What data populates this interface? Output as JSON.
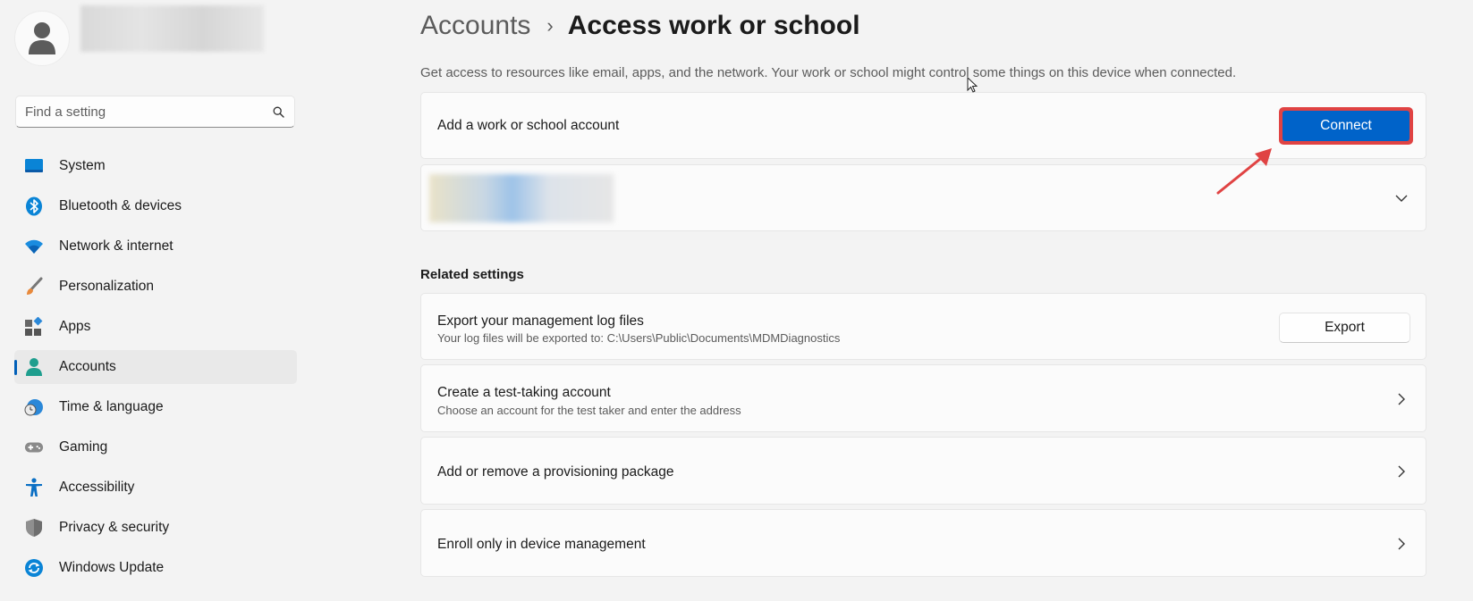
{
  "sidebar": {
    "search_placeholder": "Find a setting",
    "items": [
      {
        "label": "System",
        "icon": "monitor-icon"
      },
      {
        "label": "Bluetooth & devices",
        "icon": "bluetooth-icon"
      },
      {
        "label": "Network & internet",
        "icon": "wifi-icon"
      },
      {
        "label": "Personalization",
        "icon": "paintbrush-icon"
      },
      {
        "label": "Apps",
        "icon": "apps-icon"
      },
      {
        "label": "Accounts",
        "icon": "accounts-icon",
        "active": true
      },
      {
        "label": "Time & language",
        "icon": "clock-globe-icon"
      },
      {
        "label": "Gaming",
        "icon": "gamepad-icon"
      },
      {
        "label": "Accessibility",
        "icon": "accessibility-icon"
      },
      {
        "label": "Privacy & security",
        "icon": "shield-icon"
      },
      {
        "label": "Windows Update",
        "icon": "update-icon"
      }
    ]
  },
  "header": {
    "parent": "Accounts",
    "separator": "›",
    "current": "Access work or school"
  },
  "description": "Get access to resources like email, apps, and the network. Your work or school might control some things on this device when connected.",
  "add_account": {
    "label": "Add a work or school account",
    "button": "Connect"
  },
  "related": {
    "title": "Related settings",
    "export": {
      "title": "Export your management log files",
      "subtitle": "Your log files will be exported to: C:\\Users\\Public\\Documents\\MDMDiagnostics",
      "button": "Export"
    },
    "test_account": {
      "title": "Create a test-taking account",
      "subtitle": "Choose an account for the test taker and enter the address"
    },
    "provisioning": {
      "title": "Add or remove a provisioning package"
    },
    "enroll": {
      "title": "Enroll only in device management"
    }
  },
  "colors": {
    "accent": "#0063c9",
    "highlight": "#e04343"
  }
}
